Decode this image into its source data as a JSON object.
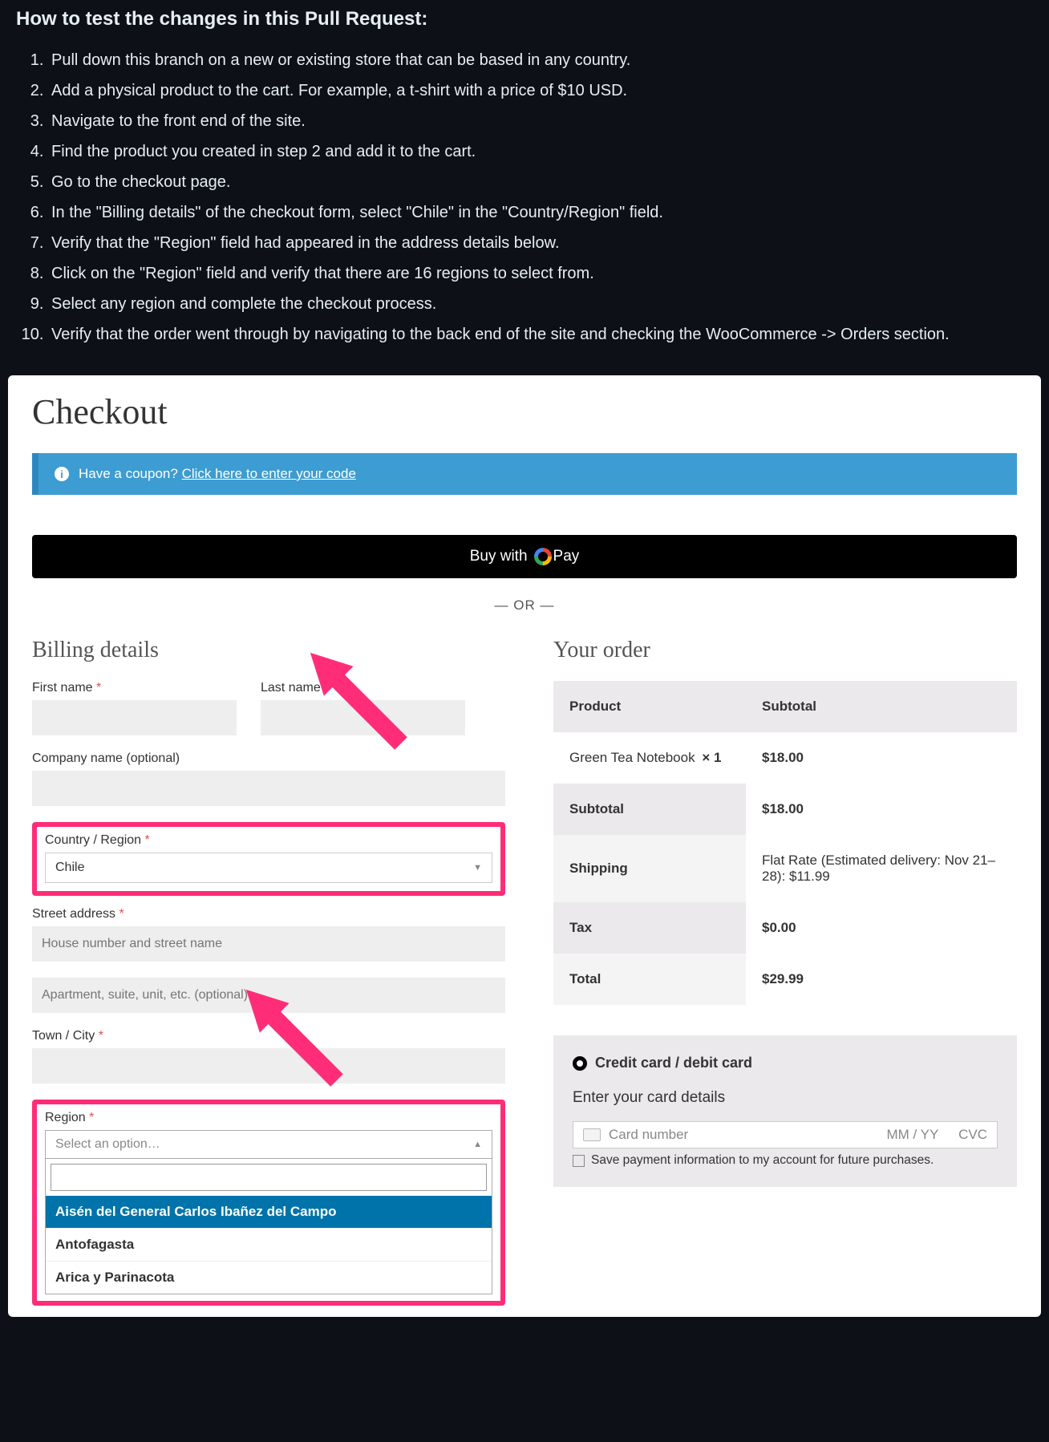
{
  "doc": {
    "heading": "How to test the changes in this Pull Request:",
    "steps": [
      "Pull down this branch on a new or existing store that can be based in any country.",
      "Add a physical product to the cart. For example, a t-shirt with a price of $10 USD.",
      "Navigate to the front end of the site.",
      "Find the product you created in step 2 and add it to the cart.",
      "Go to the checkout page.",
      "In the \"Billing details\" of the checkout form, select \"Chile\" in the \"Country/Region\" field.",
      "Verify that the \"Region\" field had appeared in the address details below.",
      "Click on the \"Region\" field and verify that there are 16 regions to select from.",
      "Select any region and complete the checkout process.",
      "Verify that the order went through by navigating to the back end of the site and checking the WooCommerce -> Orders section."
    ]
  },
  "checkout": {
    "title": "Checkout",
    "coupon_text": "Have a coupon?",
    "coupon_link": "Click here to enter your code",
    "gpay_prefix": "Buy with",
    "gpay_brand": "Pay",
    "or": "— OR —",
    "billing_heading": "Billing details",
    "order_heading": "Your order",
    "labels": {
      "first_name": "First name",
      "last_name": "Last name",
      "company": "Company name (optional)",
      "country": "Country / Region",
      "street": "Street address",
      "town": "Town / City",
      "region": "Region",
      "req": "*"
    },
    "values": {
      "country_selected": "Chile",
      "street1_placeholder": "House number and street name",
      "street2_placeholder": "Apartment, suite, unit, etc. (optional)",
      "region_placeholder": "Select an option…"
    },
    "region_options": [
      "Aisén del General Carlos Ibañez del Campo",
      "Antofagasta",
      "Arica y Parinacota"
    ],
    "order": {
      "col_product": "Product",
      "col_subtotal": "Subtotal",
      "line_item_name": "Green Tea Notebook",
      "line_item_qty": "× 1",
      "line_item_price": "$18.00",
      "subtotal_label": "Subtotal",
      "subtotal_value": "$18.00",
      "shipping_label": "Shipping",
      "shipping_value": "Flat Rate (Estimated delivery: Nov 21–28): $11.99",
      "tax_label": "Tax",
      "tax_value": "$0.00",
      "total_label": "Total",
      "total_value": "$29.99"
    },
    "payment": {
      "method": "Credit card / debit card",
      "enter_details": "Enter your card details",
      "card_number_ph": "Card number",
      "exp_ph": "MM / YY",
      "cvc_ph": "CVC",
      "save_text": "Save payment information to my account for future purchases."
    }
  }
}
